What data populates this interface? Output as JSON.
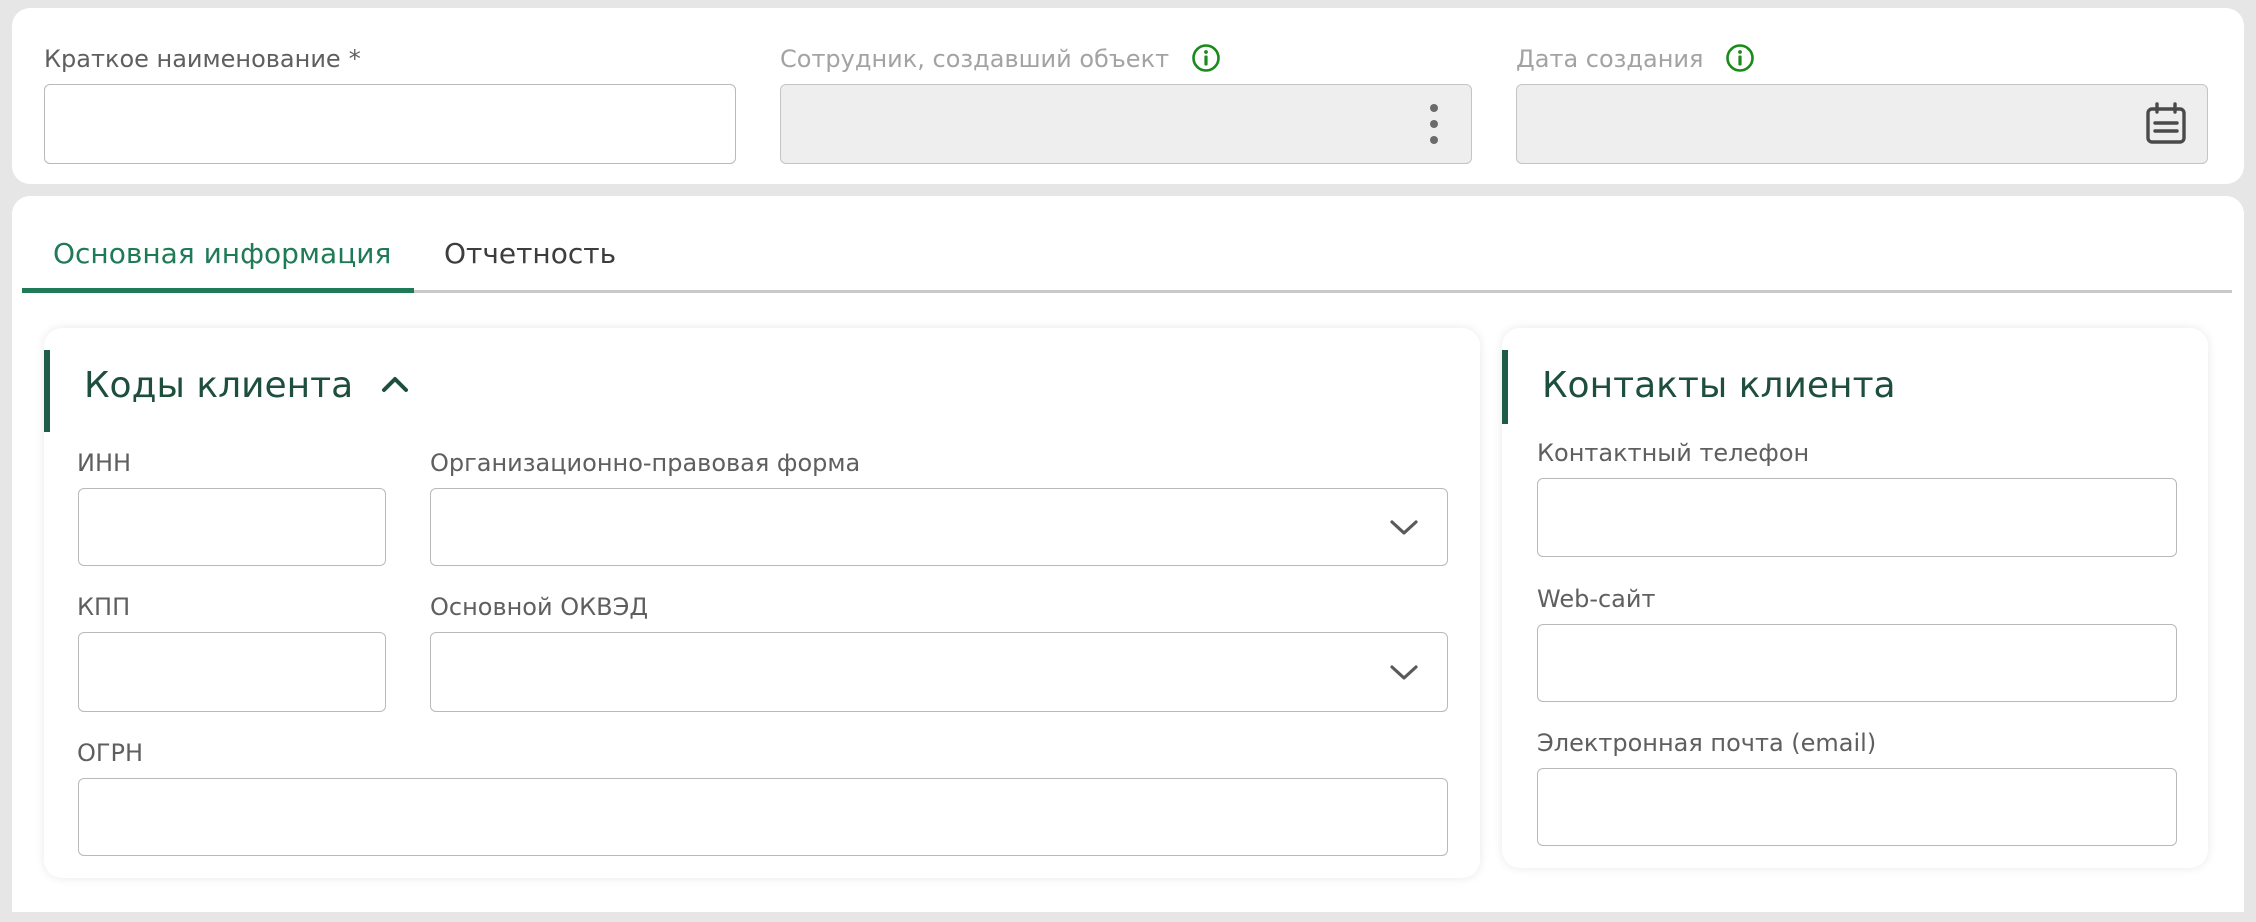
{
  "header": {
    "short_name": {
      "label": "Краткое наименование",
      "required_mark": "*",
      "value": ""
    },
    "created_by": {
      "label": "Сотрудник, создавший объект",
      "icon": "info-icon",
      "value": ""
    },
    "created_date": {
      "label": "Дата создания",
      "icon": "info-icon",
      "value": ""
    }
  },
  "tabs": [
    {
      "label": "Основная информация",
      "active": true
    },
    {
      "label": "Отчетность",
      "active": false
    }
  ],
  "client_codes": {
    "title": "Коды клиента",
    "inn": {
      "label": "ИНН",
      "value": ""
    },
    "legal_form": {
      "label": "Организационно-правовая форма",
      "value": ""
    },
    "kpp": {
      "label": "КПП",
      "value": ""
    },
    "okved": {
      "label": "Основной ОКВЭД",
      "value": ""
    },
    "ogrn": {
      "label": "ОГРН",
      "value": ""
    }
  },
  "client_contacts": {
    "title": "Контакты клиента",
    "phone": {
      "label": "Контактный телефон",
      "value": ""
    },
    "website": {
      "label": "Web-сайт",
      "value": ""
    },
    "email": {
      "label": "Электронная почта (email)",
      "value": ""
    }
  },
  "colors": {
    "accent": "#1f7a57",
    "info_icon": "#1a8a1a",
    "section_title": "#1e4f3d",
    "disabled_bg": "#eeeeee"
  }
}
